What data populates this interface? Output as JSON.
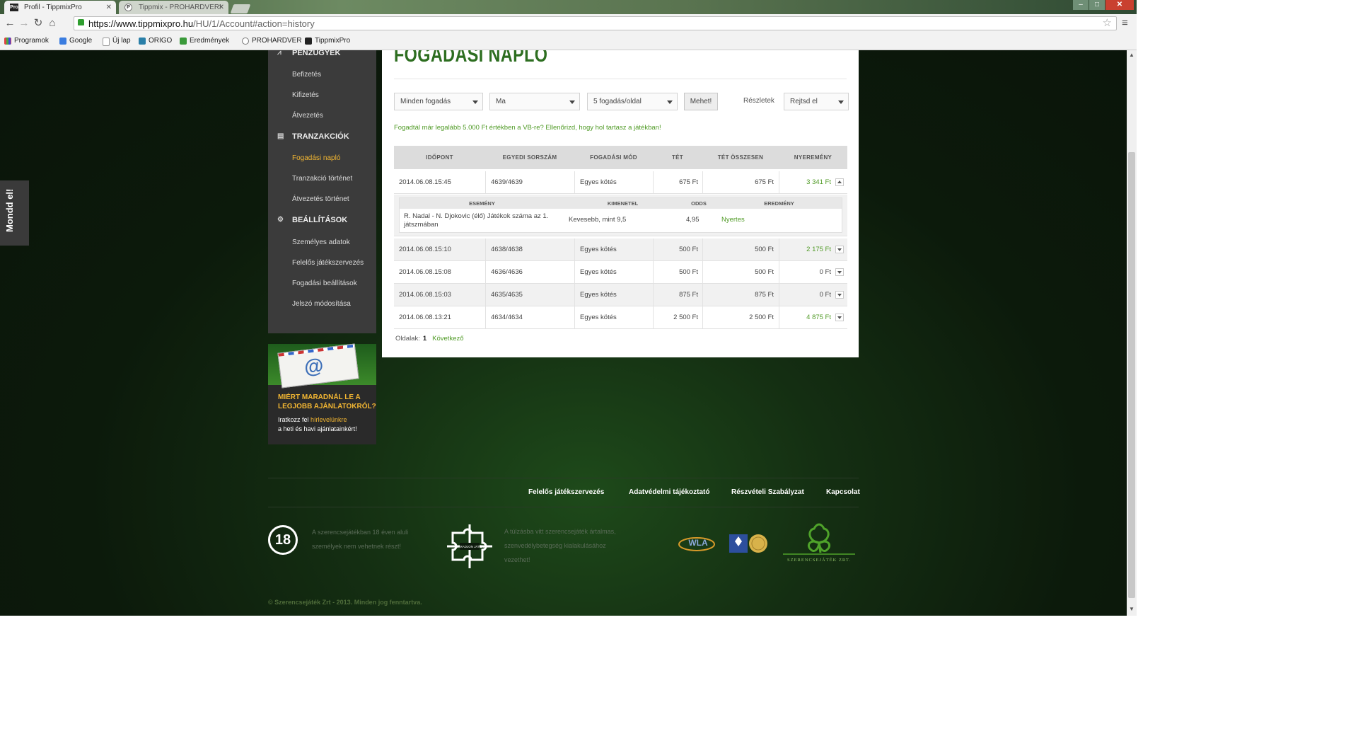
{
  "browser": {
    "tabs": [
      {
        "label": "Profil - TippmixPro",
        "active": true
      },
      {
        "label": "Tippmix - PROHARDVER!",
        "active": false
      }
    ],
    "url_host": "https://www.tippmixpro.hu",
    "url_path": "/HU/1/Account#action=history",
    "bookmarks": [
      "Programok",
      "Google",
      "Új lap",
      "ORIGO",
      "Eredmények",
      "PROHARDVER",
      "TippmixPro"
    ]
  },
  "feedback_tab": "Mondd el!",
  "sidebar": {
    "sections": [
      {
        "heading": "PÉNZÜGYEK",
        "items": [
          "Befizetés",
          "Kifizetés",
          "Átvezetés"
        ]
      },
      {
        "heading": "TRANZAKCIÓK",
        "items": [
          "Fogadási napló",
          "Tranzakció történet",
          "Átvezetés történet"
        ]
      },
      {
        "heading": "BEÁLLÍTÁSOK",
        "items": [
          "Személyes adatok",
          "Felelős játékszervezés",
          "Fogadási beállítások",
          "Jelszó módosítása"
        ]
      }
    ],
    "active_item": "Fogadási napló"
  },
  "newsletter": {
    "title1": "MIÉRT MARADNÁL LE A",
    "title2": "LEGJOBB AJÁNLATOKRÓL?",
    "sub1_pre": "Iratkozz fel ",
    "sub1_link": "hírlevelünkre",
    "sub2": "a heti és havi ajánlatainkért!"
  },
  "main": {
    "title": "FOGADÁSI NAPLÓ",
    "filters": {
      "bet_type": "Minden fogadás",
      "period": "Ma",
      "per_page": "5 fogadás/oldal",
      "go": "Mehet!",
      "details_label": "Részletek",
      "details_value": "Rejtsd el"
    },
    "notice": "Fogadtál már legalább 5.000 Ft értékben a VB-re? Ellenőrizd, hogy hol tartasz a játékban!",
    "columns": [
      "IDŐPONT",
      "EGYEDI SORSZÁM",
      "FOGADÁSI MÓD",
      "TÉT",
      "TÉT ÖSSZESEN",
      "NYEREMÉNY"
    ],
    "rows": [
      {
        "time": "2014.06.08.15:45",
        "serial": "4639/4639",
        "mode": "Egyes kötés",
        "stake": "675 Ft",
        "total": "675 Ft",
        "win": "3 341 Ft",
        "expanded": true
      },
      {
        "time": "2014.06.08.15:10",
        "serial": "4638/4638",
        "mode": "Egyes kötés",
        "stake": "500 Ft",
        "total": "500 Ft",
        "win": "2 175 Ft"
      },
      {
        "time": "2014.06.08.15:08",
        "serial": "4636/4636",
        "mode": "Egyes kötés",
        "stake": "500 Ft",
        "total": "500 Ft",
        "win": "0 Ft"
      },
      {
        "time": "2014.06.08.15:03",
        "serial": "4635/4635",
        "mode": "Egyes kötés",
        "stake": "875 Ft",
        "total": "875 Ft",
        "win": "0 Ft"
      },
      {
        "time": "2014.06.08.13:21",
        "serial": "4634/4634",
        "mode": "Egyes kötés",
        "stake": "2 500 Ft",
        "total": "2 500 Ft",
        "win": "4 875 Ft"
      }
    ],
    "detail": {
      "columns": [
        "ESEMÉNY",
        "KIMENETEL",
        "ODDS",
        "EREDMÉNY"
      ],
      "event": "R. Nadal - N. Djokovic (élő) Játékok száma az 1. játszmában",
      "outcome": "Kevesebb, mint 9,5",
      "odds": "4,95",
      "result": "Nyertes"
    },
    "pager": {
      "label": "Oldalak:",
      "current": "1",
      "next": "Következő"
    }
  },
  "footer": {
    "links": [
      "Felelős játékszervezés",
      "Adatvédelmi tájékoztató",
      "Részvételi Szabályzat",
      "Kapcsolat"
    ],
    "age_badge": "18",
    "age_text1": "A szerencsejátékban 18 éven aluli",
    "age_text2": "személyek nem vehetnek részt!",
    "addiction_text1": "A túlzásba vitt szerencsejáték ártalmas,",
    "addiction_text2": "szenvedélybetegség kialakulásához",
    "addiction_text3": "vezethet!",
    "puzzle_label": "MARADJON JÁTÉK",
    "wla": "WLA",
    "company_logo": "SZERENCSEJÁTÉK ZRT.",
    "copyright": "© Szerencsejáték Zrt - 2013. Minden jog fenntartva."
  },
  "colors": {
    "accent_green": "#4f9a25",
    "title_green": "#2d6e20",
    "sidebar_active": "#f2b632",
    "sidebar_bg": "#3b3b3b"
  }
}
